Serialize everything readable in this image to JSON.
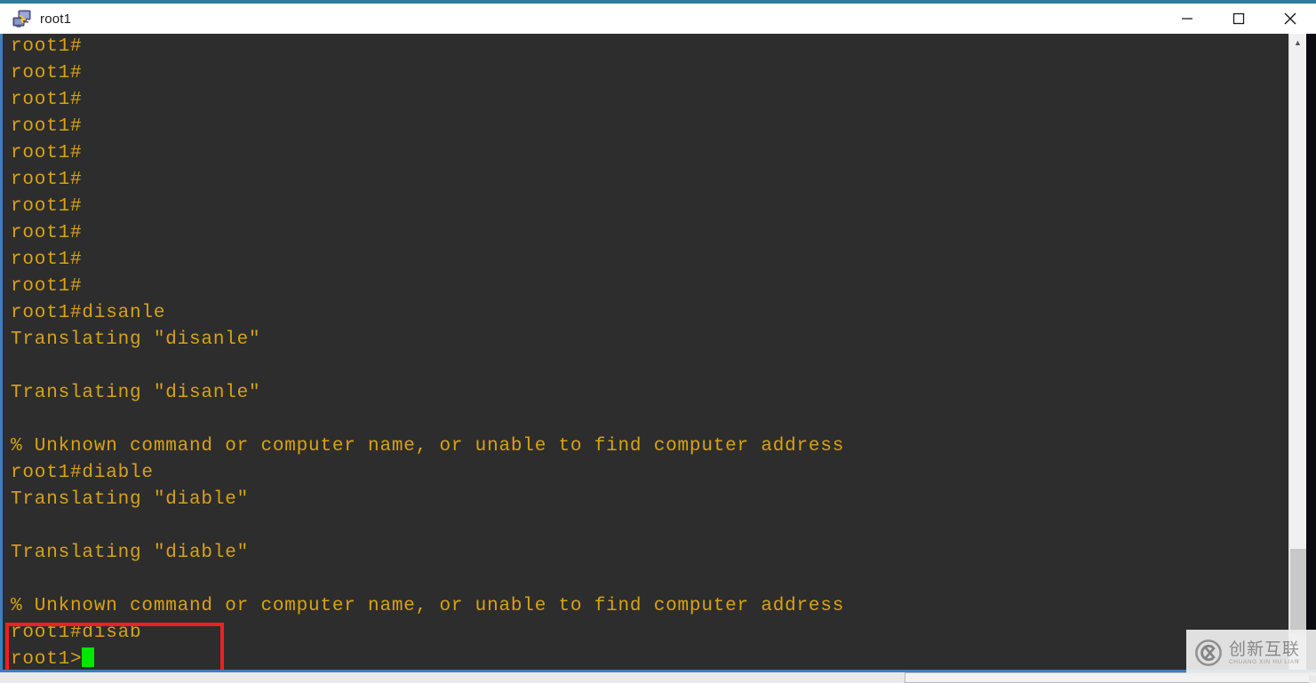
{
  "window": {
    "title": "root1",
    "icon": "remote-desktop-icon",
    "controls": {
      "minimize_label": "—",
      "maximize_label": "□",
      "close_label": "✕"
    },
    "colors": {
      "title_bar_accent": "#2d7d9e",
      "terminal_background": "#2d2d2d",
      "terminal_text": "#d8a215",
      "cursor": "#00e800",
      "highlight_box": "#ee2020",
      "left_border": "#3b7fbf"
    }
  },
  "terminal": {
    "lines": [
      "root1#",
      "root1#",
      "root1#",
      "root1#",
      "root1#",
      "root1#",
      "root1#",
      "root1#",
      "root1#",
      "root1#",
      "root1#disanle",
      "Translating \"disanle\"",
      "",
      "Translating \"disanle\"",
      "",
      "% Unknown command or computer name, or unable to find computer address",
      "root1#diable",
      "Translating \"diable\"",
      "",
      "Translating \"diable\"",
      "",
      "% Unknown command or computer name, or unable to find computer address",
      "root1#disab"
    ],
    "prompt_line": "root1>",
    "cursor_visible": true
  },
  "scrollbar": {
    "up_arrow": "▲",
    "down_arrow": "▼",
    "thumb_position_percent": 81
  },
  "watermark": {
    "chinese": "创新互联",
    "pinyin": "CHUANG XIN HU LIAN",
    "logo": "cx-circle-logo"
  }
}
